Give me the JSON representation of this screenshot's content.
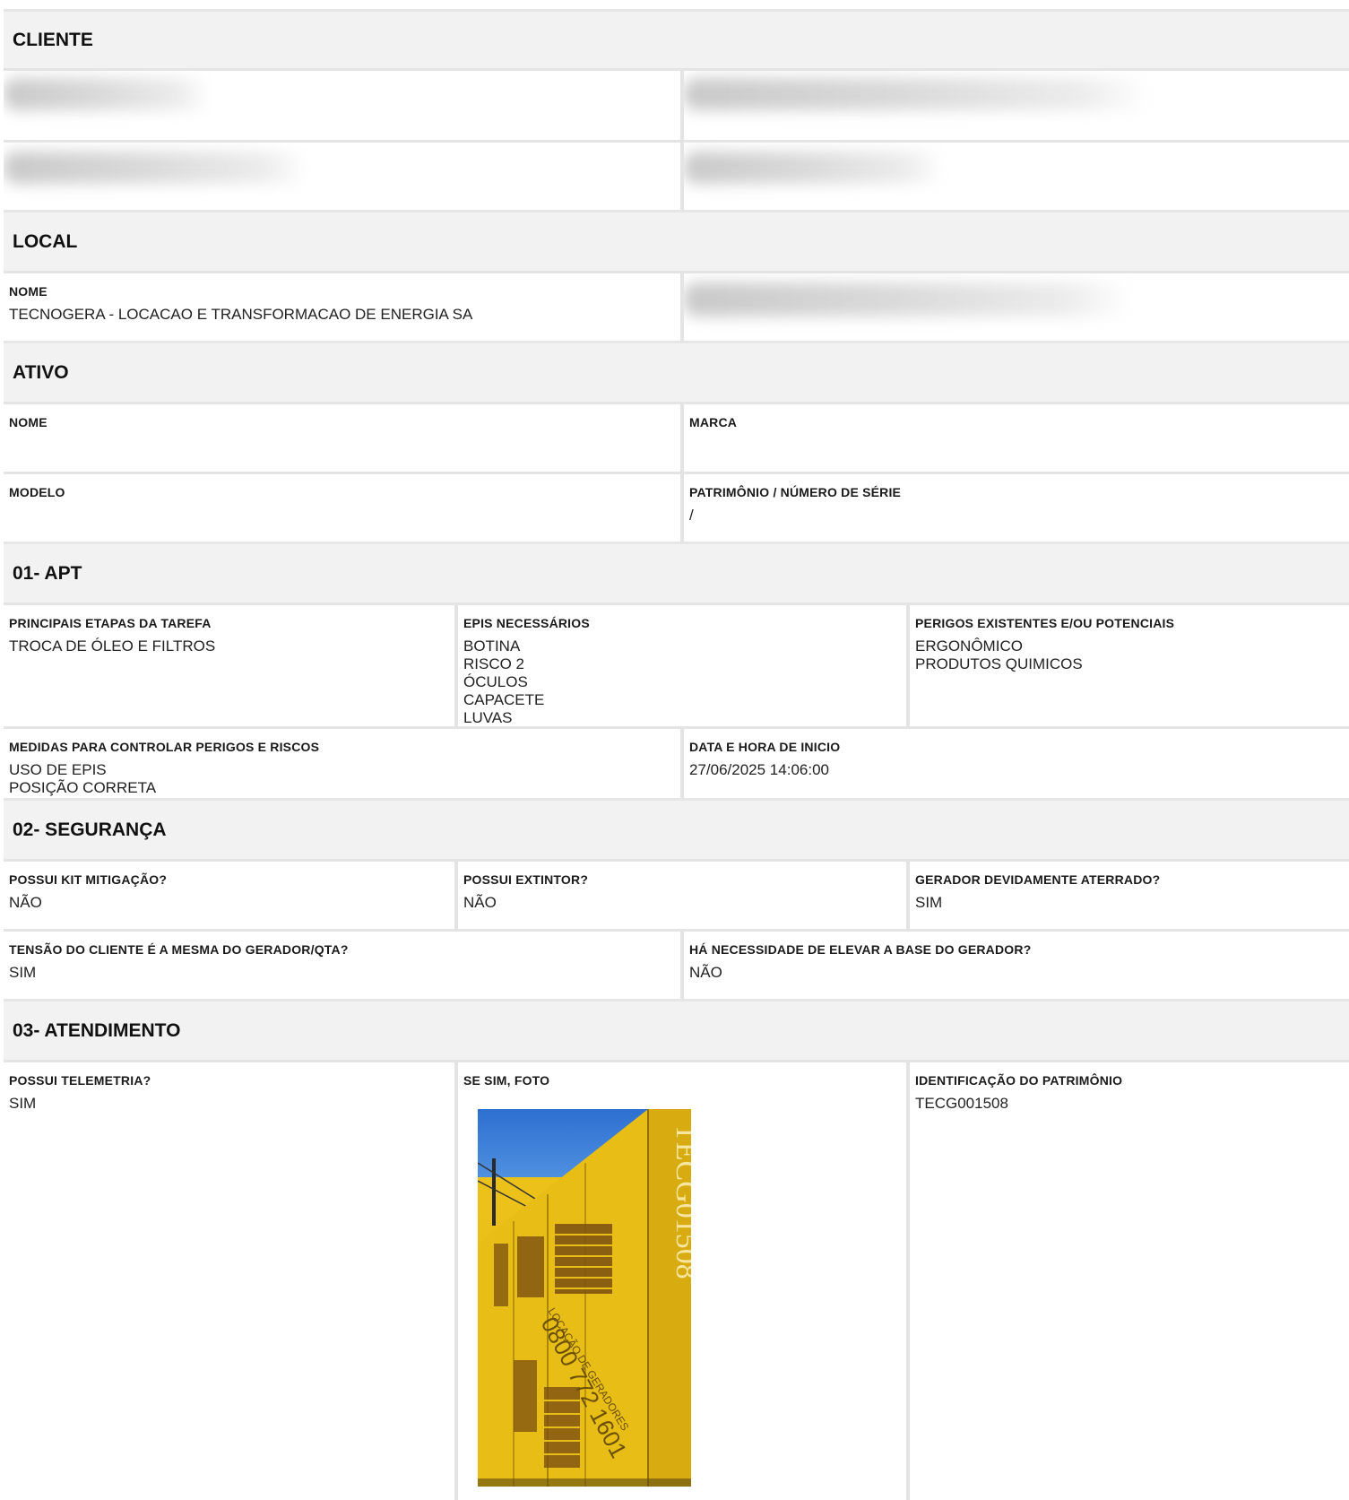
{
  "cliente": {
    "title": "CLIENTE"
  },
  "local": {
    "title": "LOCAL",
    "nome_label": "NOME",
    "nome_value": "TECNOGERA - LOCACAO E TRANSFORMACAO DE ENERGIA SA"
  },
  "ativo": {
    "title": "ATIVO",
    "nome_label": "NOME",
    "nome_value": "",
    "marca_label": "MARCA",
    "marca_value": "",
    "modelo_label": "MODELO",
    "modelo_value": "",
    "patrimonio_label": "PATRIMÔNIO / NÚMERO DE SÉRIE",
    "patrimonio_value": "/"
  },
  "apt": {
    "title": "01- APT",
    "etapas_label": "PRINCIPAIS ETAPAS DA TAREFA",
    "etapas_value": "TROCA DE ÓLEO E FILTROS",
    "epis_label": "EPIS NECESSÁRIOS",
    "epis_value": "BOTINA\nRISCO 2\nÓCULOS\nCAPACETE\nLUVAS",
    "perigos_label": "PERIGOS EXISTENTES E/OU POTENCIAIS",
    "perigos_value": "ERGONÔMICO\nPRODUTOS QUIMICOS",
    "medidas_label": "MEDIDAS PARA CONTROLAR PERIGOS E RISCOS",
    "medidas_value": "USO DE EPIS\nPOSIÇÃO CORRETA",
    "data_label": "DATA E HORA DE INICIO",
    "data_value": "27/06/2025 14:06:00"
  },
  "seguranca": {
    "title": "02- SEGURANÇA",
    "kit_label": "POSSUI KIT MITIGAÇÃO?",
    "kit_value": "NÃO",
    "extintor_label": "POSSUI EXTINTOR?",
    "extintor_value": "NÃO",
    "aterrado_label": "GERADOR DEVIDAMENTE ATERRADO?",
    "aterrado_value": "SIM",
    "tensao_label": "TENSÃO DO CLIENTE É A MESMA DO GERADOR/QTA?",
    "tensao_value": "SIM",
    "elevar_label": "HÁ NECESSIDADE DE ELEVAR A BASE DO GERADOR?",
    "elevar_value": "NÃO"
  },
  "atendimento": {
    "title": "03- ATENDIMENTO",
    "telemetria_label": "POSSUI TELEMETRIA?",
    "telemetria_value": "SIM",
    "foto_label": "SE SIM, FOTO",
    "identificacao_label": "IDENTIFICAÇÃO DO PATRIMÔNIO",
    "identificacao_value": "TECG001508",
    "photo_vertical_text": "TECG01508",
    "photo_side_text": "LOCAÇÃO DE GERADORES",
    "photo_phone_text": "0800 772 1601"
  },
  "colors": {
    "section_bg": "#f2f2f2",
    "cell_bg": "#ffffff",
    "border": "#e4e4e4",
    "generator_yellow": "#e8bd16"
  }
}
